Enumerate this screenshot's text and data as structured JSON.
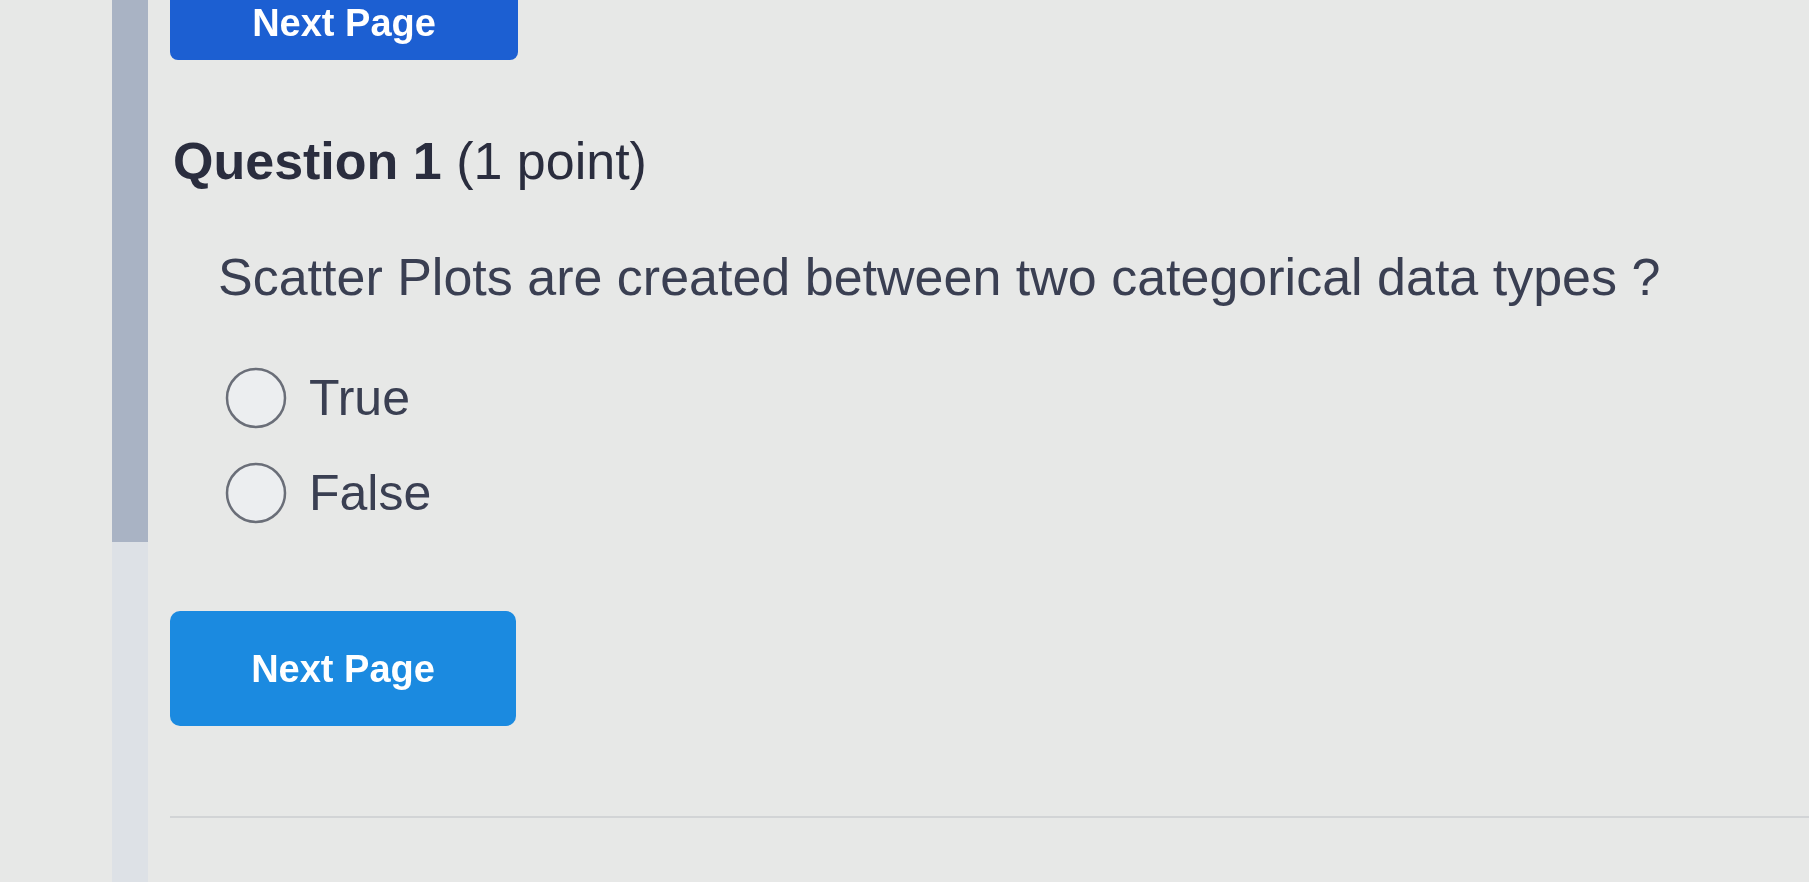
{
  "top_button": {
    "label": "Next Page"
  },
  "question": {
    "title": "**Question 1** (1 point)",
    "text": "Scatter Plots are created between two categorical data types ?",
    "options": [
      {
        "label": "True",
        "selected": false
      },
      {
        "label": "False",
        "selected": false
      }
    ]
  },
  "next_button": {
    "label": "Next Page"
  }
}
